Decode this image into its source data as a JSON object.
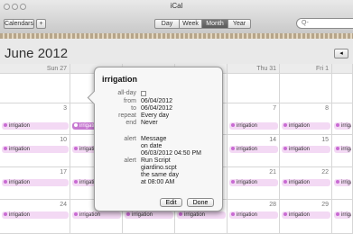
{
  "window": {
    "title": "iCal"
  },
  "toolbar": {
    "calendars_label": "Calendars",
    "add_label": "+",
    "views": [
      "Day",
      "Week",
      "Month",
      "Year"
    ],
    "active_view": "Month",
    "search_placeholder": "Q-"
  },
  "month": {
    "title": "June 2012",
    "nav_prev_label": "◂"
  },
  "weekdays": {
    "sun": "Sun 27",
    "thu": "Thu 31",
    "fri": "Fri 1"
  },
  "day_numbers": {
    "r2": [
      "3",
      "7",
      "8"
    ],
    "r3": [
      "10",
      "14",
      "15"
    ],
    "r4": [
      "17",
      "21",
      "22"
    ],
    "r5": [
      "24",
      "28",
      "29"
    ]
  },
  "event": {
    "title": "irrigation",
    "color": "#c96bd3"
  },
  "popover": {
    "title": "irrigation",
    "allday_label": "all-day",
    "from_label": "from",
    "from_value": "06/04/2012",
    "to_label": "to",
    "to_value": "06/04/2012",
    "repeat_label": "repeat",
    "repeat_value": "Every day",
    "end_label": "end",
    "end_value": "Never",
    "alert1_label": "alert",
    "alert1_lines": [
      "Message",
      "on date",
      "06/03/2012 04:50 PM"
    ],
    "alert2_label": "alert",
    "alert2_lines": [
      "Run Script",
      "giardino.scpt",
      "the same day",
      "at 08:00 AM"
    ],
    "edit_label": "Edit",
    "done_label": "Done"
  }
}
